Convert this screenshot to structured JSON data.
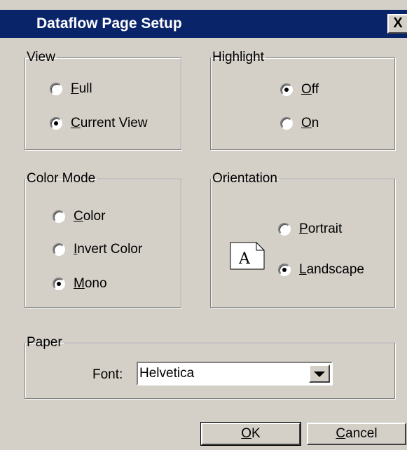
{
  "window": {
    "title": "Dataflow Page Setup",
    "close_label": "X"
  },
  "view": {
    "legend": "View",
    "options": [
      {
        "mnemonic": "F",
        "rest": "ull",
        "checked": false
      },
      {
        "mnemonic": "C",
        "rest": "urrent View",
        "checked": true
      }
    ]
  },
  "highlight": {
    "legend": "Highlight",
    "options": [
      {
        "mnemonic": "O",
        "rest": "ff",
        "checked": true
      },
      {
        "mnemonic": "O",
        "rest": "n",
        "checked": false
      }
    ]
  },
  "color_mode": {
    "legend": "Color Mode",
    "options": [
      {
        "mnemonic": "C",
        "rest": "olor",
        "checked": false
      },
      {
        "mnemonic": "I",
        "rest": "nvert Color",
        "checked": false
      },
      {
        "mnemonic": "M",
        "rest": "ono",
        "checked": true
      }
    ]
  },
  "orientation": {
    "legend": "Orientation",
    "icon_letter": "A",
    "options": [
      {
        "mnemonic": "P",
        "rest": "ortrait",
        "checked": false
      },
      {
        "mnemonic": "L",
        "rest": "andscape",
        "checked": true
      }
    ]
  },
  "paper": {
    "legend": "Paper",
    "font_label": "Font:",
    "font_value": "Helvetica"
  },
  "buttons": {
    "ok_mnemonic": "O",
    "ok_rest": "K",
    "cancel_mnemonic": "C",
    "cancel_rest": "ancel"
  },
  "colors": {
    "dialog_bg": "#d4d0c8",
    "titlebar": "#0a246a"
  }
}
